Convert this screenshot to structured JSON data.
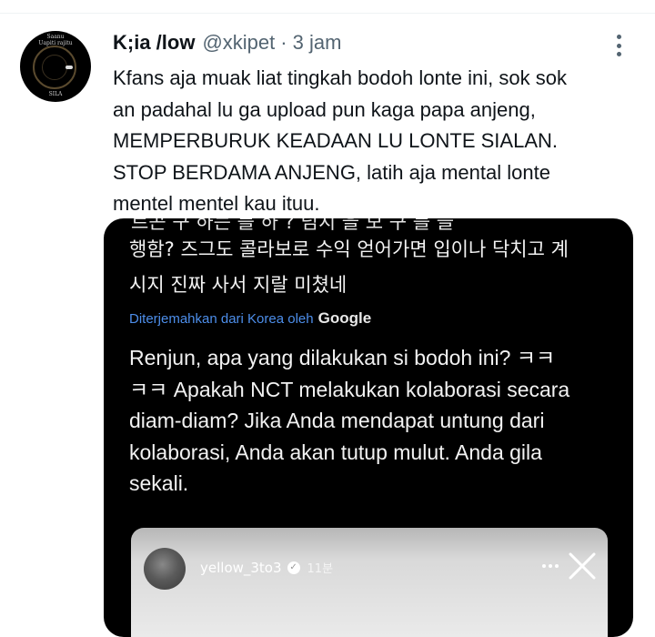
{
  "tweet": {
    "display_name": "K;ia /low",
    "handle": "@xkipet",
    "separator": "·",
    "time": "3 jam",
    "text_lines": [
      "Kfans aja muak liat tingkah bodoh lonte ini, sok sok",
      "an padahal lu ga upload pun kaga papa anjeng,",
      "MEMPERBURUK KEADAAN LU LONTE SIALAN.",
      "STOP BERDAMA ANJENG, latih aja mental lonte",
      "mentel mentel kau ituu."
    ]
  },
  "avatar": {
    "top_text": "Saanu\nUapiti rajitu",
    "bottom_text": "SILA"
  },
  "media": {
    "cut_line": "르곤 구 하는   를 하 ?          넘치 을 보 구     를 늘",
    "korean_lines": [
      "행함? 즈그도 콜라보로 수익 얻어가면 입이나 닥치고 계",
      "시지 진짜 사서 지랄 미쳤네"
    ],
    "translated_label": "Diterjemahkan dari Korea oleh",
    "translated_brand": "Google",
    "translation_lines": [
      "Renjun, apa yang dilakukan si bodoh ini? ㅋㅋ",
      "ㅋㅋ Apakah NCT melakukan kolaborasi secara",
      "diam-diam? Jika Anda mendapat untung dari",
      "kolaborasi, Anda akan tutup mulut. Anda gila",
      "sekali."
    ],
    "story": {
      "username": "yellow_3to3",
      "badge": "✓",
      "ago": "11분"
    }
  },
  "icons": {
    "more": "more-vertical-icon",
    "close": "close-icon"
  },
  "colors": {
    "link_blue": "#4d8eea",
    "secondary_text": "#536471"
  }
}
